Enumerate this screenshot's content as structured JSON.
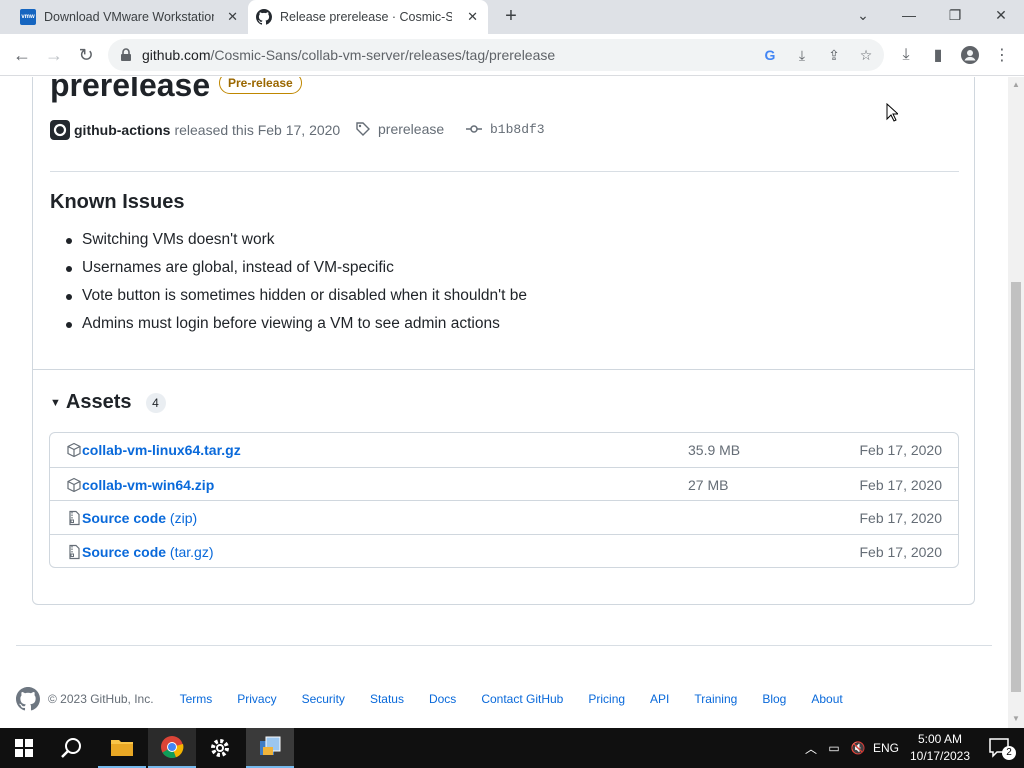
{
  "browser": {
    "tabs": [
      {
        "title": "Download VMware Workstation P",
        "favicon": "vmware-favicon",
        "favicon_text": "vmw"
      },
      {
        "title": "Release prerelease · Cosmic-Sans",
        "favicon": "github-favicon",
        "active": true
      }
    ],
    "url_host": "github.com",
    "url_path": "/Cosmic-Sans/collab-vm-server/releases/tag/prerelease"
  },
  "release": {
    "title": "prerelease",
    "badge": "Pre-release",
    "author": "github-actions",
    "released_text": "released this Feb 17, 2020",
    "tag": "prerelease",
    "commit": "b1b8df3"
  },
  "known_issues": {
    "heading": "Known Issues",
    "items": [
      "Switching VMs doesn't work",
      "Usernames are global, instead of VM-specific",
      "Vote button is sometimes hidden or disabled when it shouldn't be",
      "Admins must login before viewing a VM to see admin actions"
    ]
  },
  "assets": {
    "heading": "Assets",
    "count": "4",
    "rows": [
      {
        "name": "collab-vm-linux64.tar.gz",
        "suffix": "",
        "size": "35.9 MB",
        "date": "Feb 17, 2020",
        "icon": "package-icon"
      },
      {
        "name": "collab-vm-win64.zip",
        "suffix": "",
        "size": "27 MB",
        "date": "Feb 17, 2020",
        "icon": "package-icon"
      },
      {
        "name": "Source code",
        "suffix": " (zip)",
        "size": "",
        "date": "Feb 17, 2020",
        "icon": "file-zip-icon"
      },
      {
        "name": "Source code",
        "suffix": " (tar.gz)",
        "size": "",
        "date": "Feb 17, 2020",
        "icon": "file-zip-icon"
      }
    ]
  },
  "footer": {
    "copyright": "© 2023 GitHub, Inc.",
    "links": [
      "Terms",
      "Privacy",
      "Security",
      "Status",
      "Docs",
      "Contact GitHub",
      "Pricing",
      "API",
      "Training",
      "Blog",
      "About"
    ]
  },
  "taskbar": {
    "lang": "ENG",
    "time": "5:00 AM",
    "date": "10/17/2023",
    "notifications": "2"
  },
  "colors": {
    "link": "#0969da",
    "badge": "#9a6700",
    "taskbar": "#101010"
  }
}
